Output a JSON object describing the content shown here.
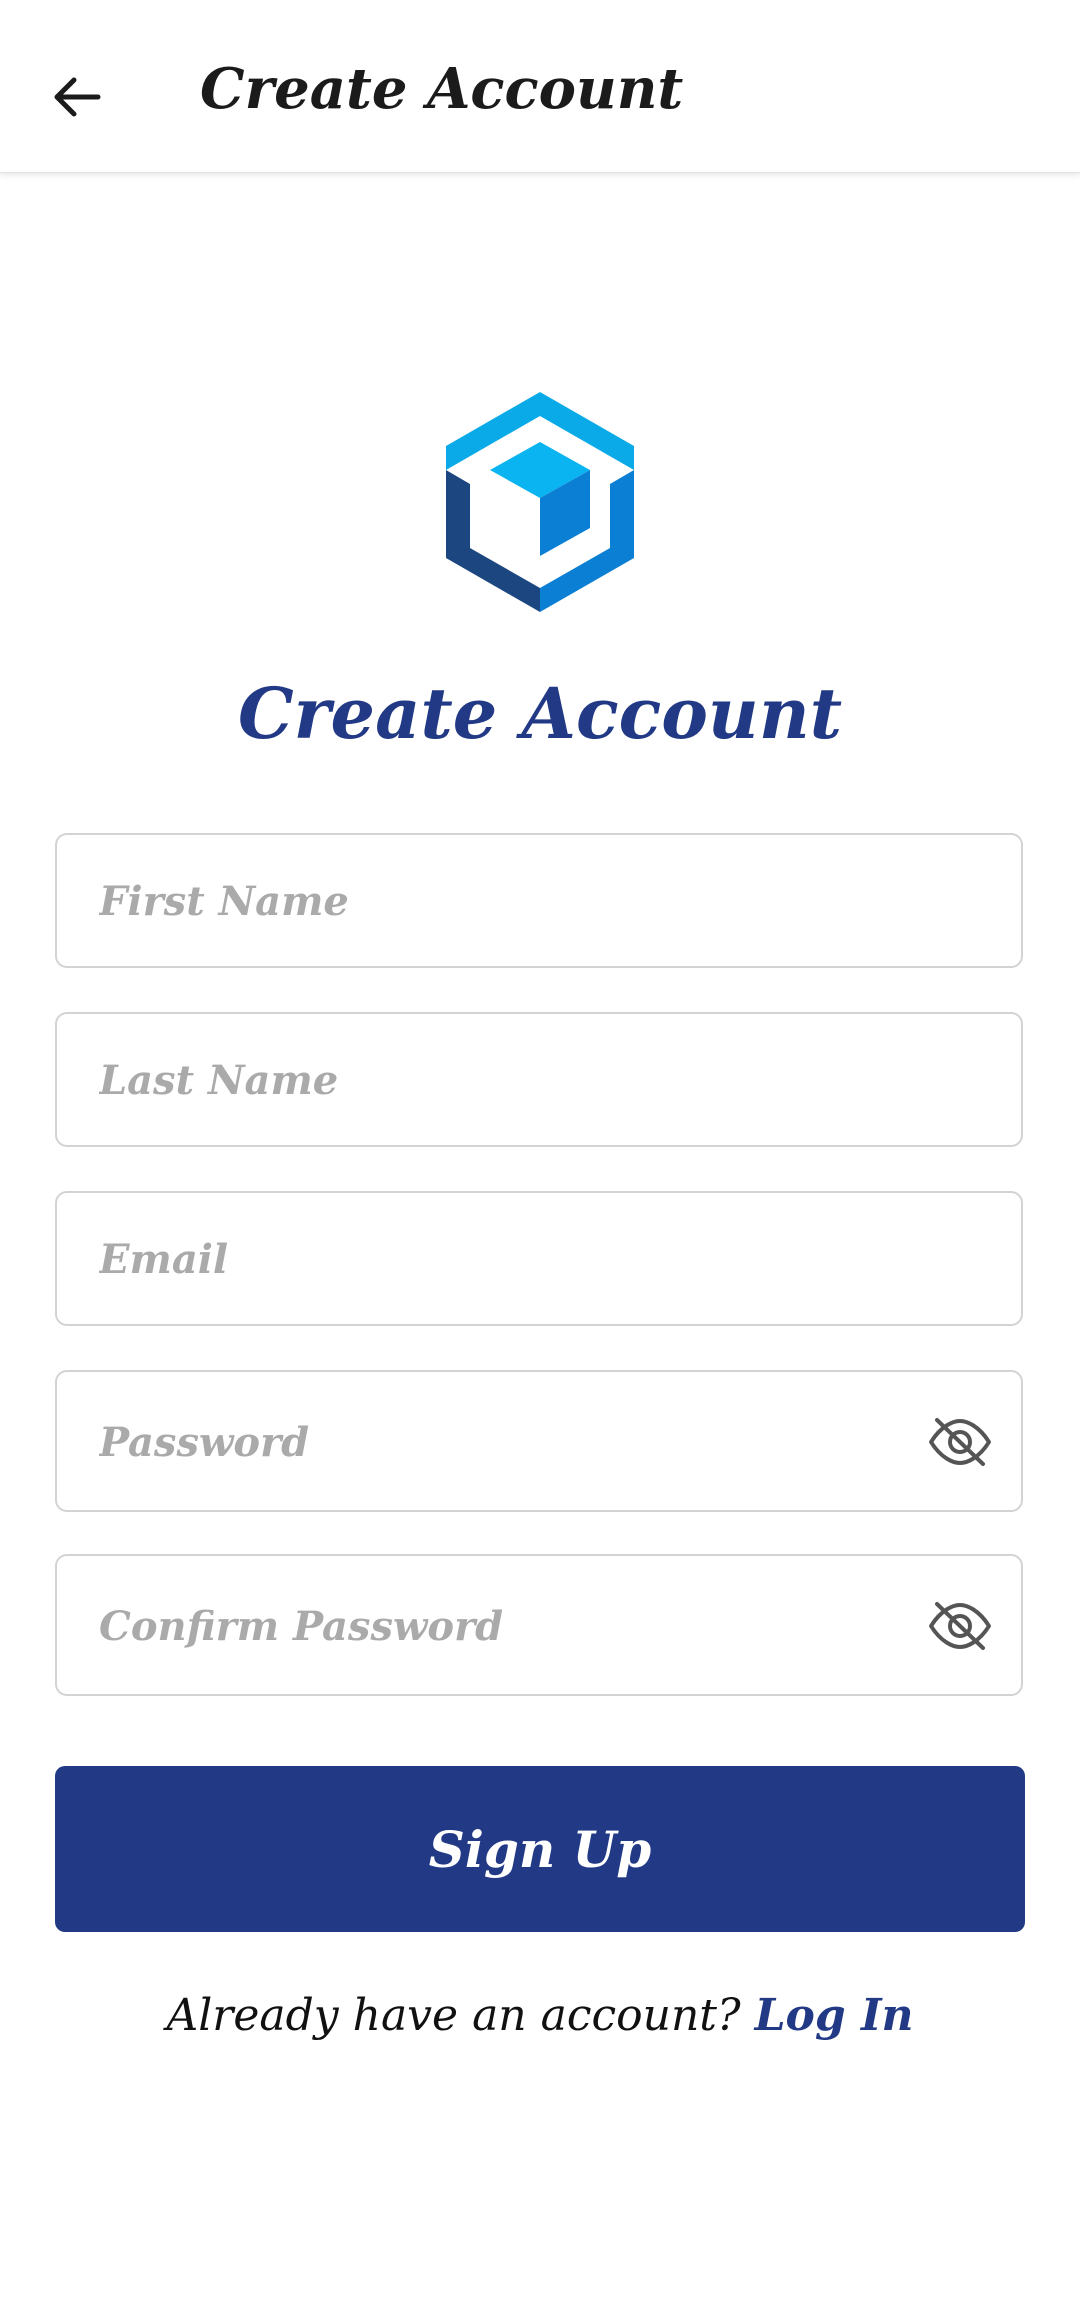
{
  "header": {
    "title": "Create Account",
    "back_icon": "arrow-left-icon"
  },
  "logo": {
    "icon": "cube-logo-icon",
    "colors": [
      "#0aaae8",
      "#0a7fd4",
      "#1c4680"
    ]
  },
  "page": {
    "title": "Create Account"
  },
  "form": {
    "first_name": {
      "placeholder": "First Name",
      "value": ""
    },
    "last_name": {
      "placeholder": "Last Name",
      "value": ""
    },
    "email": {
      "placeholder": "Email",
      "value": ""
    },
    "password": {
      "placeholder": "Password",
      "value": "",
      "toggle_icon": "eye-off-icon"
    },
    "confirm_password": {
      "placeholder": "Confirm Password",
      "value": "",
      "toggle_icon": "eye-off-icon"
    },
    "submit_label": "Sign Up"
  },
  "footer": {
    "prompt": "Already have an account?",
    "link": "Log In"
  },
  "colors": {
    "accent": "#223a86",
    "field_border": "#d3d3d3",
    "placeholder": "#aaaaaa"
  }
}
